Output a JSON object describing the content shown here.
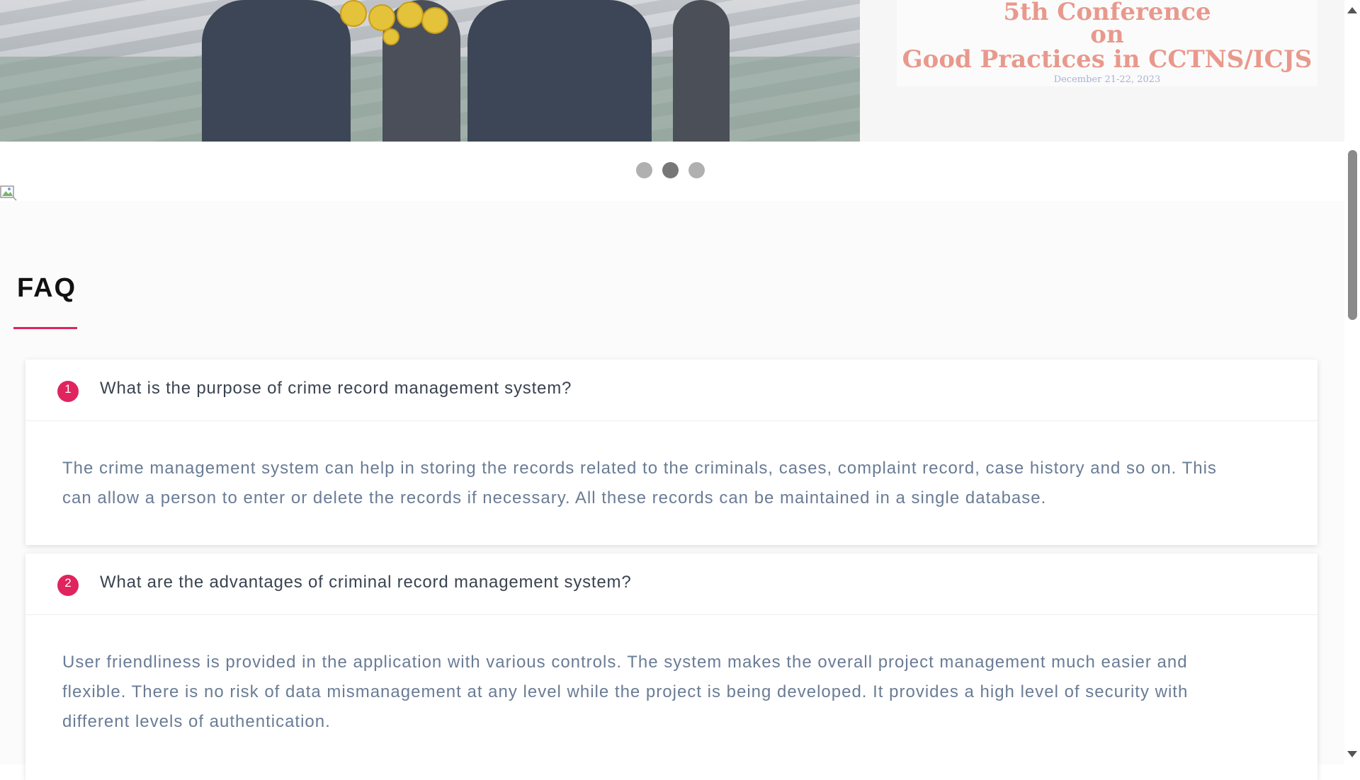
{
  "carousel": {
    "banner": {
      "line1": "5th Conference",
      "line2": "on",
      "line3": "Good Practices in CCTNS/ICJS",
      "date": "December 21-22, 2023"
    },
    "dots": [
      {
        "active": false
      },
      {
        "active": true
      },
      {
        "active": false
      }
    ]
  },
  "faq": {
    "title": "FAQ",
    "accent_color": "#e0245e",
    "items": [
      {
        "number": "1",
        "question": "What is the purpose of crime record management system?",
        "answer_lines": [
          "The crime management system can help in storing the records related to the criminals, cases, complaint record, case history and so on. This",
          "can allow a person to enter or delete the records if necessary. All these records can be maintained in a single database."
        ]
      },
      {
        "number": "2",
        "question": "What are the advantages of criminal record management system?",
        "answer_lines": [
          "User friendliness is provided in the application with various controls. The system makes the overall project management much easier and",
          "flexible. There is no risk of data mismanagement at any level while the project is being developed. It provides a high level of security with",
          "different levels of authentication."
        ]
      }
    ]
  }
}
